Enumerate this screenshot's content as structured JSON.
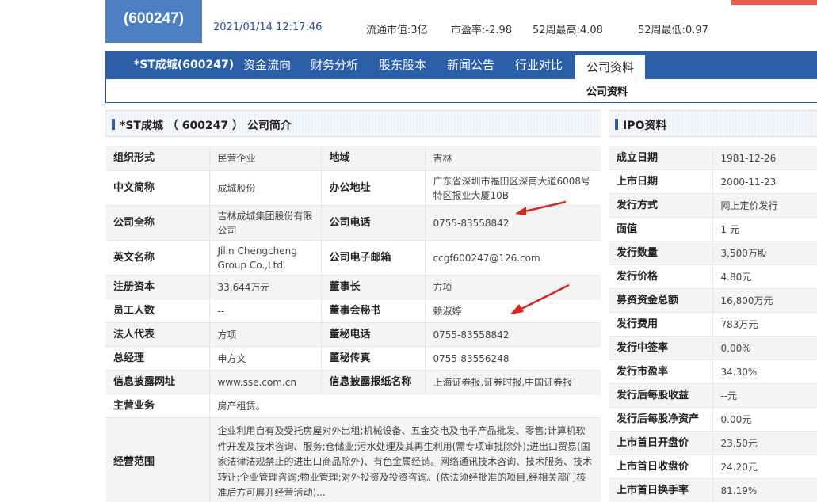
{
  "quote": {
    "code": "(600247)",
    "timestamp": "2021/01/14 12:17:46",
    "circ_mktcap_label": "流通市值:",
    "circ_mktcap_value": "3亿",
    "pe_label": "市盈率:",
    "pe_value": "-2.98",
    "high52_label": "52周最高:",
    "high52_value": "4.08",
    "low52_label": "52周最低:",
    "low52_value": "0.97",
    "colors": {
      "up": "#e01a1a",
      "down": "#0a9a3a",
      "brand": "#2a5ea6"
    }
  },
  "nav": {
    "tabs": [
      {
        "label": "*ST成城(600247)"
      },
      {
        "label": "资金流向"
      },
      {
        "label": "财务分析"
      },
      {
        "label": "股东股本"
      },
      {
        "label": "新闻公告"
      },
      {
        "label": "行业对比"
      },
      {
        "label": "公司资料"
      }
    ],
    "sub_label": "公司资料"
  },
  "intro": {
    "title": "*ST成城 （ 600247 ） 公司简介",
    "rows": [
      {
        "k1": "组织形式",
        "v1": "民营企业",
        "k2": "地域",
        "v2": "吉林"
      },
      {
        "k1": "中文简称",
        "v1": "成城股份",
        "k2": "办公地址",
        "v2": "广东省深圳市福田区深南大道6008号特区报业大厦10B"
      },
      {
        "k1": "公司全称",
        "v1": "吉林成城集团股份有限公司",
        "k2": "公司电话",
        "v2": "0755-83558842"
      },
      {
        "k1": "英文名称",
        "v1": "Jilin Chengcheng Group Co.,Ltd.",
        "k2": "公司电子邮箱",
        "v2": "ccgf600247@126.com"
      },
      {
        "k1": "注册资本",
        "v1": "33,644万元",
        "k2": "董事长",
        "v2": "方项"
      },
      {
        "k1": "员工人数",
        "v1": "--",
        "k2": "董事会秘书",
        "v2": "赖淑婷"
      },
      {
        "k1": "法人代表",
        "v1": "方项",
        "k2": "董秘电话",
        "v2": "0755-83558842"
      },
      {
        "k1": "总经理",
        "v1": "申方文",
        "k2": "董秘传真",
        "v2": "0755-83556248"
      },
      {
        "k1": "信息披露网址",
        "v1": "www.sse.com.cn",
        "k2": "信息披露报纸名称",
        "v2": "上海证券报,证券时报,中国证券报"
      }
    ],
    "main_business_label": "主营业务",
    "main_business": "房产租赁。",
    "scope_label": "经营范围",
    "scope": "企业利用自有及受托房屋对外出租;机械设备、五金交电及电子产品批发、零售;计算机软件开发及技术咨询、服务;仓储业;污水处理及其再生利用(需专项审批除外);进出口贸易(国家法律法规禁止的进出口商品除外)、有色金属经销。网络通讯技术咨询、技术服务、技术转让;企业管理咨询;物业管理;对外投资及投资咨询。(依法须经批准的项目,经相关部门核准后方可展开经营活动)..."
  },
  "ipo": {
    "title": "IPO资料",
    "rows": [
      {
        "k": "成立日期",
        "v": "1981-12-26"
      },
      {
        "k": "上市日期",
        "v": "2000-11-23"
      },
      {
        "k": "发行方式",
        "v": "网上定价发行"
      },
      {
        "k": "面值",
        "v": "1 元"
      },
      {
        "k": "发行数量",
        "v": "3,500万股"
      },
      {
        "k": "发行价格",
        "v": "4.80元"
      },
      {
        "k": "募资资金总额",
        "v": "16,800万元"
      },
      {
        "k": "发行费用",
        "v": "783万元"
      },
      {
        "k": "发行中签率",
        "v": "0.00%"
      },
      {
        "k": "发行市盈率",
        "v": "34.30%"
      },
      {
        "k": "发行后每股收益",
        "v": "--元"
      },
      {
        "k": "发行后每股净资产",
        "v": "0.00元"
      },
      {
        "k": "上市首日开盘价",
        "v": "23.50元"
      },
      {
        "k": "上市首日收盘价",
        "v": "24.20元"
      },
      {
        "k": "上市首日换手率",
        "v": "81.19%"
      }
    ]
  }
}
